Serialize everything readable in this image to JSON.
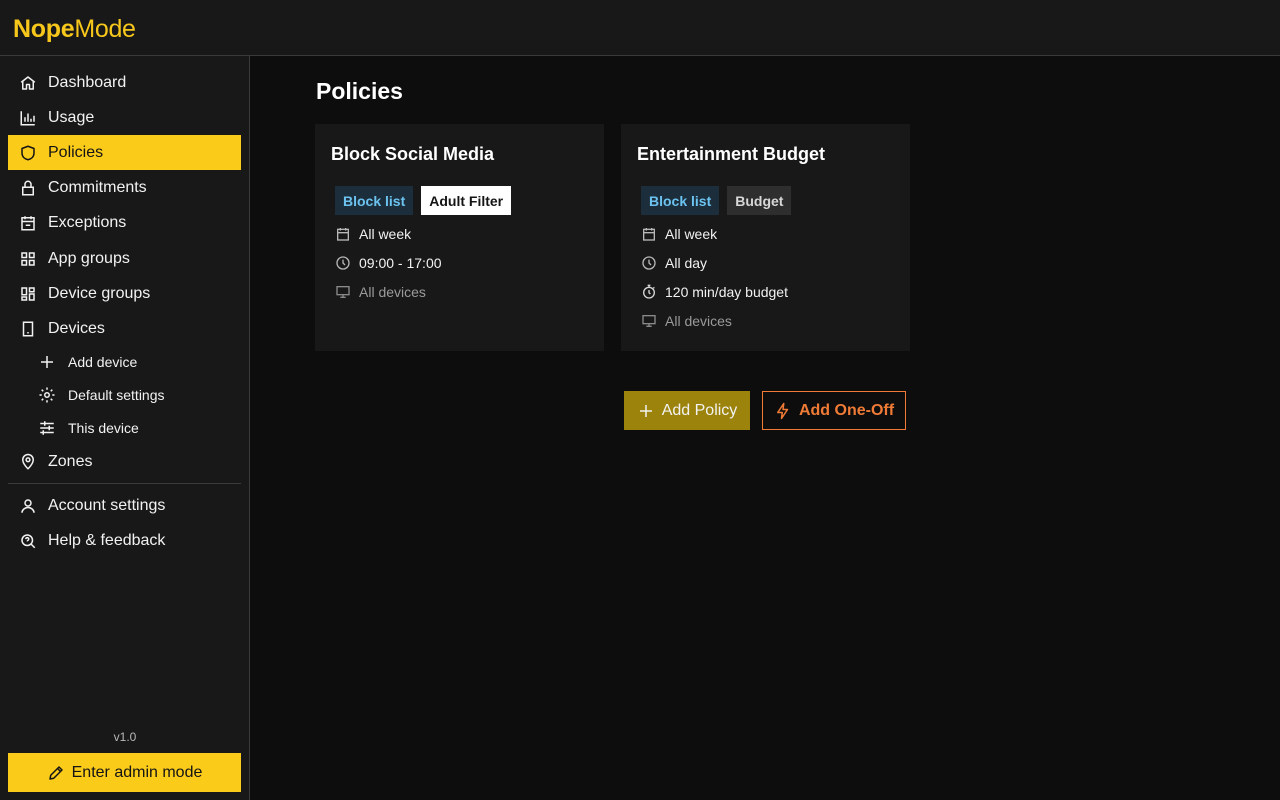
{
  "app": {
    "logo_bold": "Nope",
    "logo_light": "Mode"
  },
  "sidebar": {
    "items": [
      {
        "label": "Dashboard",
        "icon": "home-icon"
      },
      {
        "label": "Usage",
        "icon": "bar-chart-icon"
      },
      {
        "label": "Policies",
        "icon": "shield-icon",
        "active": true
      },
      {
        "label": "Commitments",
        "icon": "lock-icon"
      },
      {
        "label": "Exceptions",
        "icon": "calendar-icon"
      },
      {
        "label": "App groups",
        "icon": "grid-icon"
      },
      {
        "label": "Device groups",
        "icon": "layout-icon"
      },
      {
        "label": "Devices",
        "icon": "phone-icon"
      }
    ],
    "sub_items": [
      {
        "label": "Add device",
        "icon": "plus-icon"
      },
      {
        "label": "Default settings",
        "icon": "gear-icon"
      },
      {
        "label": "This device",
        "icon": "sliders-icon"
      }
    ],
    "zones": {
      "label": "Zones",
      "icon": "map-pin-icon"
    },
    "footer_items": [
      {
        "label": "Account settings",
        "icon": "user-icon"
      },
      {
        "label": "Help & feedback",
        "icon": "help-chat-icon"
      }
    ],
    "version": "v1.0",
    "admin_button": "Enter admin mode"
  },
  "main": {
    "title": "Policies",
    "cards": [
      {
        "title": "Block Social Media",
        "tags": [
          "Block list",
          "Adult Filter"
        ],
        "schedule": "All week",
        "time": "09:00 - 17:00",
        "devices": "All devices"
      },
      {
        "title": "Entertainment Budget",
        "tags": [
          "Block list",
          "Budget"
        ],
        "schedule": "All week",
        "time": "All day",
        "budget": "120 min/day budget",
        "devices": "All devices"
      }
    ],
    "add_policy": "Add Policy",
    "add_one_off": "Add One-Off"
  },
  "colors": {
    "accent": "#fbcb1a",
    "orange": "#f07b36",
    "blue_tag": "#6cc3ef"
  }
}
